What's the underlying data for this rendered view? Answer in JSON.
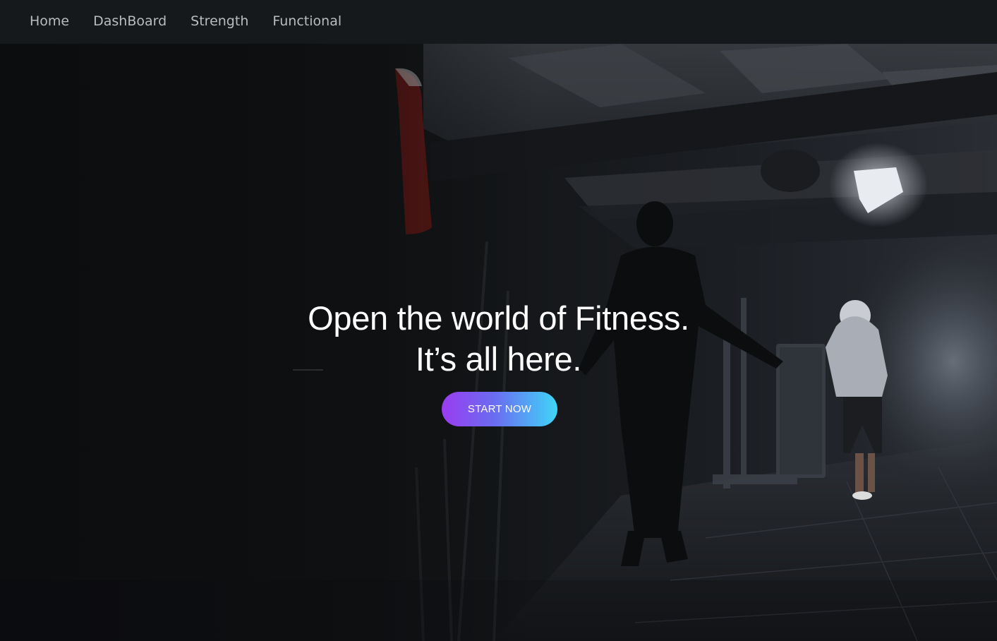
{
  "nav": {
    "items": [
      {
        "label": "Home"
      },
      {
        "label": "DashBoard"
      },
      {
        "label": "Strength"
      },
      {
        "label": "Functional"
      }
    ]
  },
  "hero": {
    "title_line1": "Open the world of Fitness.",
    "title_line2": "It’s all here.",
    "cta_label": "START NOW",
    "background_image": "dark-gym-boxers-photo"
  },
  "colors": {
    "nav_bg": "#16191b",
    "nav_text": "#b9bcbf",
    "hero_text": "#ffffff",
    "cta_gradient_start": "#9b3cf0",
    "cta_gradient_end": "#3fd6f7"
  }
}
